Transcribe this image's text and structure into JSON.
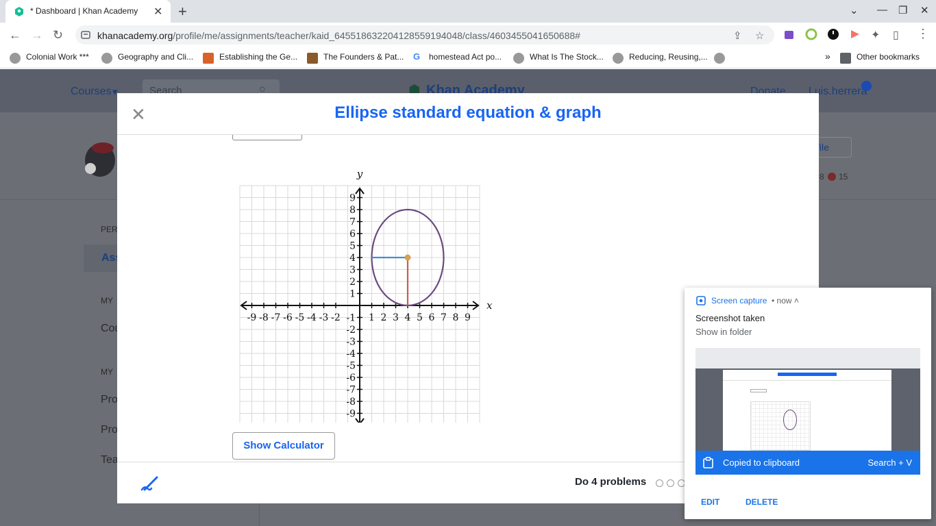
{
  "browser": {
    "tab_title": "* Dashboard | Khan Academy",
    "url_host": "khanacademy.org",
    "url_path": "/profile/me/assignments/teacher/kaid_645518632204128559194048/class/4603455041650688#",
    "bookmarks": [
      "Colonial Work ***",
      "Geography and Cli...",
      "Establishing the Ge...",
      "The Founders & Pat...",
      "homestead Act po...",
      "What Is The Stock...",
      "Reducing, Reusing,..."
    ],
    "other_bookmarks": "Other bookmarks",
    "overflow": "»"
  },
  "page": {
    "nav_courses": "Courses",
    "search_placeholder": "Search",
    "logo": "Khan Academy",
    "donate": "Donate",
    "user": "Luis.herrera",
    "sidebar_fragments": [
      "PER",
      "Ass",
      "MY",
      "Cou",
      "MY",
      "Pro",
      "Pro",
      "Tea"
    ],
    "profile_btn_fragment": "file",
    "stats_fragment_a": "8",
    "stats_fragment_b": "15"
  },
  "modal": {
    "title": "Ellipse standard equation & graph",
    "calc_button": "Show Calculator",
    "footer_text": "Do 4 problems",
    "progress_dots": 3
  },
  "chart_data": {
    "type": "line",
    "title": "",
    "xlabel": "x",
    "ylabel": "y",
    "xlim": [
      -10,
      10
    ],
    "ylim": [
      -10,
      10
    ],
    "grid": true,
    "x_ticks": [
      "-9",
      "-8",
      "-7",
      "-6",
      "-5",
      "-4",
      "-3",
      "-2",
      "1",
      "2",
      "3",
      "4",
      "5",
      "6",
      "7",
      "8",
      "9"
    ],
    "y_ticks": [
      "9",
      "8",
      "7",
      "6",
      "5",
      "4",
      "3",
      "2",
      "1",
      "-1",
      "-2",
      "-3",
      "-4",
      "-5",
      "-6",
      "-7",
      "-8",
      "-9"
    ],
    "ellipse": {
      "center": [
        4,
        4
      ],
      "rx": 3,
      "ry": 4,
      "color": "#6b4a7f"
    },
    "horizontal_segment": {
      "from": [
        1,
        4
      ],
      "to": [
        4,
        4
      ],
      "color": "#3d91cf"
    },
    "vertical_segment": {
      "from": [
        4,
        4
      ],
      "to": [
        4,
        0
      ],
      "color": "#c0614a"
    },
    "center_point": {
      "at": [
        4,
        4
      ],
      "color": "#d9a04f"
    }
  },
  "toast": {
    "app": "Screen capture",
    "time": "• now ˄",
    "title": "Screenshot taken",
    "subtitle": "Show in folder",
    "bar_text": "Copied to clipboard",
    "bar_key": "Search + V",
    "edit": "EDIT",
    "delete": "DELETE"
  },
  "colors": {
    "ka_blue": "#1865f2",
    "chrome_blue": "#1a73e8",
    "overlay": "#6b6e74"
  }
}
